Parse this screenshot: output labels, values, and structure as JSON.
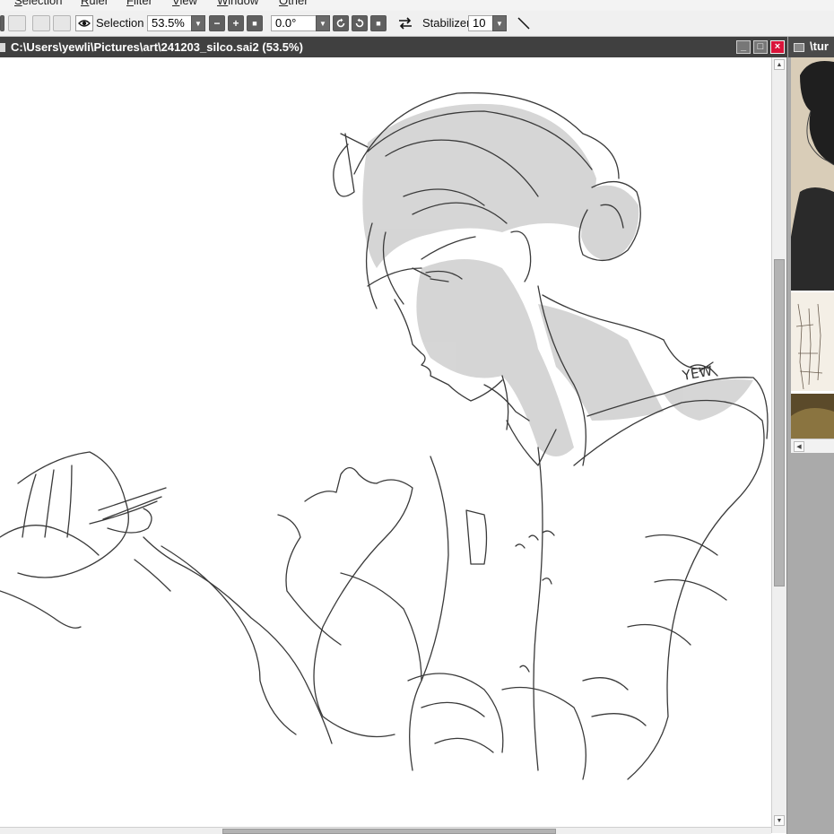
{
  "menu": {
    "items": [
      {
        "first": "S",
        "rest": "election"
      },
      {
        "first": "R",
        "rest": "uler"
      },
      {
        "first": "F",
        "rest": "ilter"
      },
      {
        "first": "V",
        "rest": "iew"
      },
      {
        "first": "W",
        "rest": "indow"
      },
      {
        "first": "O",
        "rest": "ther"
      }
    ]
  },
  "toolbar": {
    "selection_label": "Selection",
    "zoom_value": "53.5%",
    "rotation_value": "0.0°",
    "stabilizer_label": "Stabilizer",
    "stabilizer_value": "10",
    "zoom_out_label": "−",
    "zoom_in_label": "+",
    "zoom_reset_label": "■",
    "rotate_reset_label": "■"
  },
  "document": {
    "title": "C:\\Users\\yewli\\Pictures\\art\\241203_silco.sai2 (53.5%)",
    "signature": "YEW",
    "minimize_label": "_",
    "maximize_label": "□",
    "close_label": "×"
  },
  "reference": {
    "title": "\\tur"
  },
  "colors": {
    "titlebar": "#404040",
    "close_button": "#d9143a",
    "toolbar_bg": "#f0f0f0",
    "panel_bg": "#aaaaaa"
  }
}
